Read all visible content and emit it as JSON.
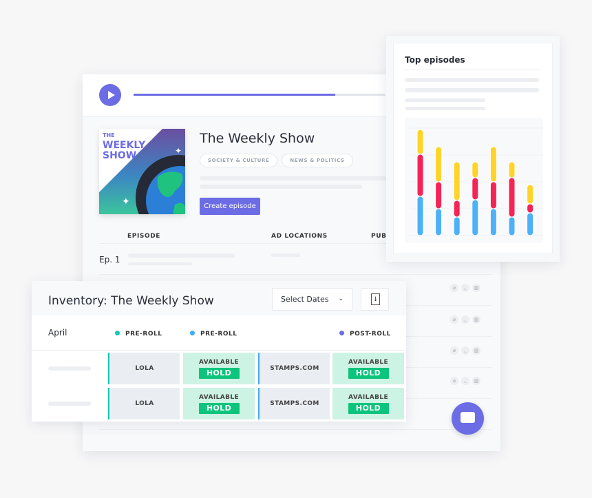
{
  "player": {
    "progress_percent": 80
  },
  "show": {
    "title": "The Weekly Show",
    "categories": [
      "SOCIETY & CULTURE",
      "NEWS & POLITICS"
    ],
    "create_label": "Create episode",
    "art_lines": [
      "THE",
      "WEEKLY",
      "SHOW"
    ]
  },
  "table": {
    "headers": [
      "EPISODE",
      "AD LOCATIONS",
      "PUB"
    ],
    "first_row": "Ep. 1"
  },
  "top_episodes": {
    "title": "Top episodes"
  },
  "chart_data": {
    "type": "bar",
    "stacked": true,
    "categories": [
      "1",
      "2",
      "3",
      "4",
      "5",
      "6",
      "7"
    ],
    "series": [
      {
        "color": "#4cb1f7",
        "values": [
          57,
          39,
          27,
          52,
          39,
          27,
          33
        ]
      },
      {
        "color": "#f52356",
        "values": [
          61,
          39,
          24,
          32,
          39,
          57,
          13
        ]
      },
      {
        "color": "#ffd42a",
        "values": [
          36,
          51,
          56,
          23,
          51,
          23,
          28
        ]
      }
    ],
    "axes_shown": false,
    "grid": true
  },
  "inventory": {
    "title": "Inventory: The Weekly Show",
    "select_dates": "Select Dates",
    "month": "April",
    "columns": [
      {
        "label": "PRE-ROLL",
        "color": "#16c9b3"
      },
      {
        "label": "PRE-ROLL",
        "color": "#42aaf5"
      },
      {
        "label": "POST-ROLL",
        "color": "#6c6ce5"
      }
    ],
    "rows": [
      {
        "cells": [
          "LOLA",
          "AVAILABLE",
          "STAMPS.COM",
          "AVAILABLE"
        ],
        "hold": "HOLD"
      },
      {
        "cells": [
          "LOLA",
          "AVAILABLE",
          "STAMPS.COM",
          "AVAILABLE"
        ],
        "hold": "HOLD"
      }
    ]
  },
  "colors": {
    "accent": "#6c6ce5",
    "hold": "#0dc47c"
  }
}
